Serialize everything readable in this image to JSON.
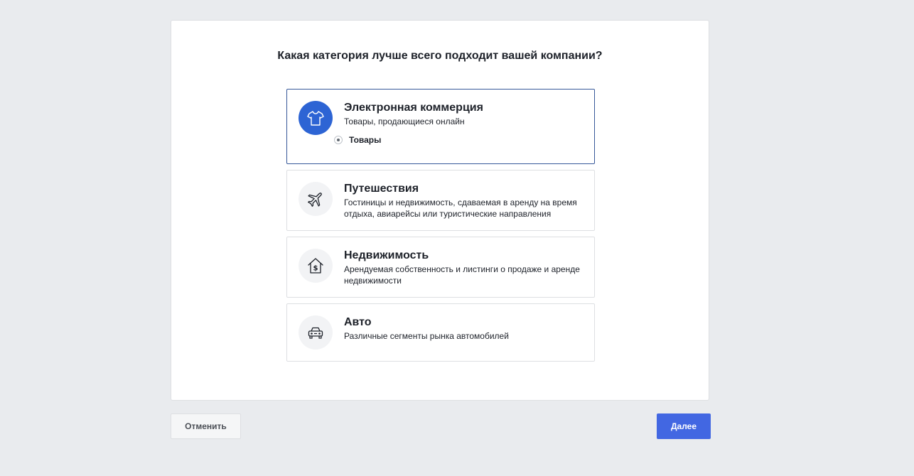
{
  "question": "Какая категория лучше всего подходит вашей компании?",
  "options": [
    {
      "title": "Электронная коммерция",
      "description": "Товары, продающиеся онлайн",
      "icon": "tshirt-icon",
      "selected": true,
      "sub_option_label": "Товары"
    },
    {
      "title": "Путешествия",
      "description": "Гостиницы и недвижимость, сдаваемая в аренду на время отдыха, авиарейсы или туристические направления",
      "icon": "airplane-icon",
      "selected": false
    },
    {
      "title": "Недвижимость",
      "description": "Арендуемая собственность и листинги о продаже и аренде недвижимости",
      "icon": "house-dollar-icon",
      "selected": false
    },
    {
      "title": "Авто",
      "description": "Различные сегменты рынка автомобилей",
      "icon": "car-icon",
      "selected": false
    }
  ],
  "buttons": {
    "cancel_label": "Отменить",
    "next_label": "Далее"
  },
  "colors": {
    "accent": "#4267e2",
    "selected_icon_bg": "#2d64d4",
    "selected_border": "#365899",
    "page_bg": "#e9ebee"
  }
}
